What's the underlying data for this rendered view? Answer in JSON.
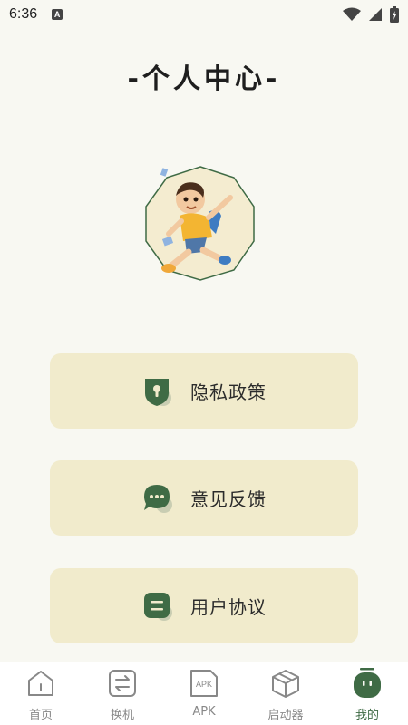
{
  "status_bar": {
    "time": "6:36",
    "badge": "A"
  },
  "page_title": "-个人中心-",
  "menu": [
    {
      "label": "隐私政策",
      "icon": "shield-lock-icon"
    },
    {
      "label": "意见反馈",
      "icon": "chat-bubble-icon"
    },
    {
      "label": "用户协议",
      "icon": "document-icon"
    }
  ],
  "tabs": [
    {
      "label": "首页",
      "icon": "home-icon",
      "active": false
    },
    {
      "label": "换机",
      "icon": "swap-icon",
      "active": false
    },
    {
      "label": "APK",
      "icon": "apk-file-icon",
      "icon_text": "APK",
      "active": false
    },
    {
      "label": "启动器",
      "icon": "box-icon",
      "active": false
    },
    {
      "label": "我的",
      "icon": "profile-icon",
      "active": true
    }
  ],
  "colors": {
    "background": "#f8f8f2",
    "card": "#f1ebcc",
    "accent": "#3f6b45",
    "inactive": "#888888"
  }
}
